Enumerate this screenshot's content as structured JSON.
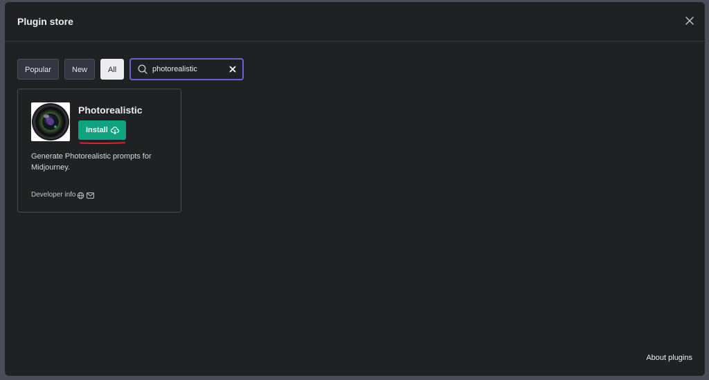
{
  "modal": {
    "title": "Plugin store",
    "close_icon": "close-icon"
  },
  "filters": {
    "popular": "Popular",
    "new": "New",
    "all": "All",
    "active": "All"
  },
  "search": {
    "value": "photorealistic",
    "icon": "search-icon",
    "clear_icon": "clear-icon"
  },
  "plugin": {
    "name": "Photorealistic",
    "install_label": "Install",
    "install_icon": "cloud-download-icon",
    "description": "Generate Photorealistic prompts for Midjourney.",
    "developer_info": "Developer info",
    "globe_icon": "globe-icon",
    "mail_icon": "mail-icon"
  },
  "footer": {
    "about_plugins": "About plugins"
  },
  "colors": {
    "accent": "#10a37f",
    "focus_border": "#6a62d8",
    "annotation": "#e0202a",
    "modal_bg": "#202123"
  }
}
